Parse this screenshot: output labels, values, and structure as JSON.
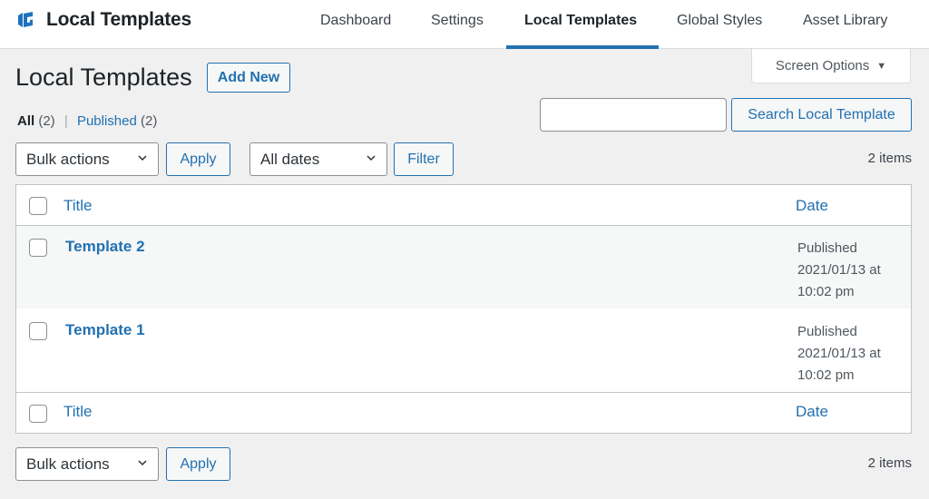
{
  "header": {
    "brand_title": "Local Templates",
    "logo_icon": "brand-logo-icon",
    "nav": [
      {
        "label": "Dashboard",
        "active": false
      },
      {
        "label": "Settings",
        "active": false
      },
      {
        "label": "Local Templates",
        "active": true
      },
      {
        "label": "Global Styles",
        "active": false
      },
      {
        "label": "Asset Library",
        "active": false
      }
    ],
    "accent_color": "#2271b1"
  },
  "screen_options": {
    "label": "Screen Options",
    "icon": "triangle-down-icon"
  },
  "page": {
    "title": "Local Templates",
    "add_new_label": "Add New"
  },
  "views": {
    "all_label": "All",
    "all_count": "(2)",
    "separator": "|",
    "published_label": "Published",
    "published_count": "(2)"
  },
  "search": {
    "value": "",
    "placeholder": "",
    "button_label": "Search Local Template"
  },
  "tablenav_top": {
    "bulk_actions_selected": "Bulk actions",
    "apply_label": "Apply",
    "dates_selected": "All dates",
    "filter_label": "Filter",
    "items_count": "2 items"
  },
  "table": {
    "columns": {
      "title": "Title",
      "date": "Date"
    },
    "rows": [
      {
        "title": "Template 2",
        "status": "Published",
        "date": "2021/01/13 at",
        "time": "10:02 pm"
      },
      {
        "title": "Template 1",
        "status": "Published",
        "date": "2021/01/13 at",
        "time": "10:02 pm"
      }
    ]
  },
  "tablenav_bottom": {
    "bulk_actions_selected": "Bulk actions",
    "apply_label": "Apply",
    "items_count": "2 items"
  }
}
